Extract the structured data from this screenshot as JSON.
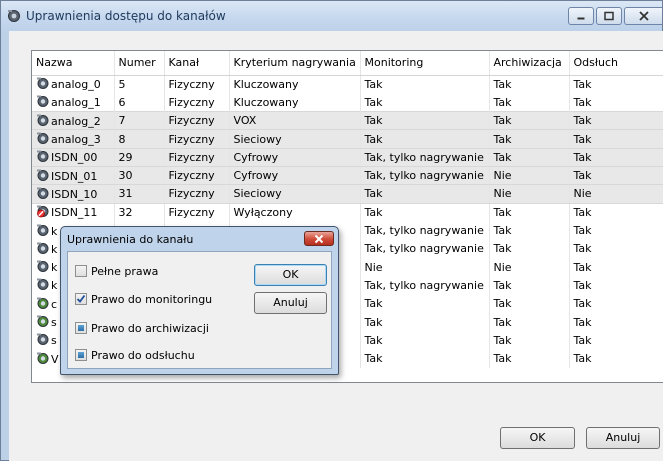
{
  "window": {
    "title": "Uprawnienia dostępu do kanałów",
    "buttons": {
      "minimize": "minimize-icon",
      "maximize": "maximize-icon",
      "close": "close-icon"
    }
  },
  "table": {
    "headers": [
      "Nazwa",
      "Numer",
      "Kanał",
      "Kryterium nagrywania",
      "Monitoring",
      "Archiwizacja",
      "Odsłuch"
    ],
    "rows": [
      {
        "name": "analog_0",
        "number": "5",
        "channel": "Fizyczny",
        "criterion": "Kluczowany",
        "monitoring": "Tak",
        "archive": "Tak",
        "listen": "Tak",
        "icon": "camera-icon",
        "selected": false
      },
      {
        "name": "analog_1",
        "number": "6",
        "channel": "Fizyczny",
        "criterion": "Kluczowany",
        "monitoring": "Tak",
        "archive": "Tak",
        "listen": "Tak",
        "icon": "camera-icon",
        "selected": false
      },
      {
        "name": "analog_2",
        "number": "7",
        "channel": "Fizyczny",
        "criterion": "VOX",
        "monitoring": "Tak",
        "archive": "Tak",
        "listen": "Tak",
        "icon": "camera-icon",
        "selected": true
      },
      {
        "name": "analog_3",
        "number": "8",
        "channel": "Fizyczny",
        "criterion": "Sieciowy",
        "monitoring": "Tak",
        "archive": "Tak",
        "listen": "Tak",
        "icon": "camera-icon",
        "selected": true
      },
      {
        "name": "ISDN_00",
        "number": "29",
        "channel": "Fizyczny",
        "criterion": "Cyfrowy",
        "monitoring": "Tak, tylko nagrywanie",
        "archive": "Tak",
        "listen": "Tak",
        "icon": "camera-icon",
        "selected": true
      },
      {
        "name": "ISDN_01",
        "number": "30",
        "channel": "Fizyczny",
        "criterion": "Cyfrowy",
        "monitoring": "Tak, tylko nagrywanie",
        "archive": "Nie",
        "listen": "Tak",
        "icon": "camera-icon",
        "selected": true
      },
      {
        "name": "ISDN_10",
        "number": "31",
        "channel": "Fizyczny",
        "criterion": "Sieciowy",
        "monitoring": "Tak",
        "archive": "Nie",
        "listen": "Nie",
        "icon": "camera-icon",
        "selected": true
      },
      {
        "name": "ISDN_11",
        "number": "32",
        "channel": "Fizyczny",
        "criterion": "Wyłączony",
        "monitoring": "Tak",
        "archive": "Tak",
        "listen": "Tak",
        "icon": "camera-disabled-icon",
        "selected": false
      },
      {
        "name": "k",
        "number": "",
        "channel": "",
        "criterion": "",
        "monitoring": "Tak, tylko nagrywanie",
        "archive": "Tak",
        "listen": "Tak",
        "icon": "camera-icon",
        "selected": false
      },
      {
        "name": "k",
        "number": "",
        "channel": "",
        "criterion": "",
        "monitoring": "Tak, tylko nagrywanie",
        "archive": "Tak",
        "listen": "Tak",
        "icon": "camera-icon",
        "selected": false
      },
      {
        "name": "k",
        "number": "",
        "channel": "",
        "criterion": "",
        "monitoring": "Nie",
        "archive": "Nie",
        "listen": "Tak",
        "icon": "camera-icon",
        "selected": false
      },
      {
        "name": "k",
        "number": "",
        "channel": "",
        "criterion": "",
        "monitoring": "Tak, tylko nagrywanie",
        "archive": "Tak",
        "listen": "Tak",
        "icon": "camera-icon",
        "selected": false
      },
      {
        "name": "c",
        "number": "",
        "channel": "",
        "criterion": "",
        "monitoring": "Tak",
        "archive": "Tak",
        "listen": "Tak",
        "icon": "camera-green-icon",
        "selected": false
      },
      {
        "name": "s",
        "number": "",
        "channel": "",
        "criterion": "",
        "monitoring": "Tak",
        "archive": "Tak",
        "listen": "Tak",
        "icon": "camera-green-icon",
        "selected": false
      },
      {
        "name": "s",
        "number": "",
        "channel": "",
        "criterion": "",
        "monitoring": "Tak",
        "archive": "Tak",
        "listen": "Tak",
        "icon": "camera-icon",
        "selected": false
      },
      {
        "name": "V",
        "number": "",
        "channel": "",
        "criterion": "",
        "monitoring": "Tak",
        "archive": "Tak",
        "listen": "Tak",
        "icon": "camera-green-icon",
        "selected": false
      }
    ]
  },
  "footer": {
    "ok_label": "OK",
    "cancel_label": "Anuluj"
  },
  "dialog": {
    "title": "Uprawnienia do kanału",
    "close_icon": "close-icon",
    "options": [
      {
        "label": "Pełne prawa",
        "state": "unchecked"
      },
      {
        "label": "Prawo do monitoringu",
        "state": "checked"
      },
      {
        "label": "Prawo do archiwizacji",
        "state": "indeterminate"
      },
      {
        "label": "Prawo do odsłuchu",
        "state": "indeterminate"
      }
    ],
    "ok_label": "OK",
    "cancel_label": "Anuluj"
  },
  "colors": {
    "accent": "#3c7fb1",
    "selected_row": "#e8e8e8",
    "close_red": "#cf4a37"
  }
}
